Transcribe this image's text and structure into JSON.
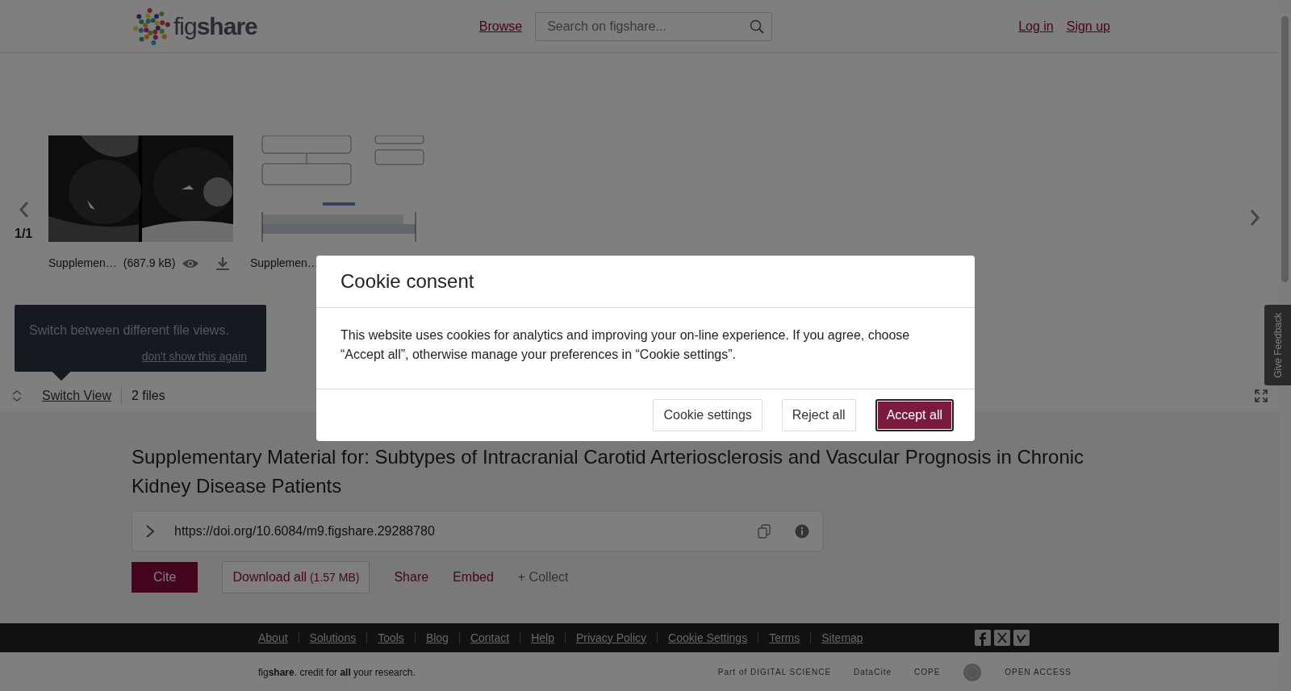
{
  "header": {
    "logo": "fig**share**",
    "browse": "Browse",
    "search": {
      "placeholder": "Search on figshare..."
    },
    "auth_links": [
      "Log in",
      "Sign up"
    ]
  },
  "viewer": {
    "counter": "1/1",
    "files": [
      {
        "name": "Supplemen…",
        "size": "(687.9 kB)",
        "kind": "scan"
      },
      {
        "name": "Supplemen…",
        "kind": "chart"
      }
    ],
    "tooltip": {
      "text": "Switch between different file views.",
      "dismiss": "don't show this again"
    },
    "switch_view": "Switch View",
    "file_count": "2 files"
  },
  "item": {
    "title": "Supplementary Material for: Subtypes of Intracranial Carotid Arteriosclerosis and Vascular Prognosis in Chronic Kidney Disease Patients",
    "doi": "https://doi.org/10.6084/m9.figshare.29288780",
    "actions": [
      {
        "label": "Cite",
        "kind": "primary"
      },
      {
        "label": "Download all",
        "size": "(1.57 MB)",
        "kind": "outline"
      },
      {
        "label": "Share",
        "kind": "link"
      },
      {
        "label": "Embed",
        "kind": "link"
      },
      {
        "label": "+ Collect",
        "kind": "muted"
      }
    ]
  },
  "footer": {
    "links": [
      "About",
      "Solutions",
      "Tools",
      "Blog",
      "Contact",
      "Help",
      "Privacy Policy",
      "Cookie Settings",
      "Terms",
      "Sitemap"
    ],
    "tagline": "fig**share**. credit for **all** your research.",
    "partners": [
      {
        "kind": "text",
        "text": "Part of DIGITAL SCIENCE"
      },
      {
        "kind": "text",
        "text": "DataCite"
      },
      {
        "kind": "text",
        "text": "COPE"
      },
      {
        "kind": "emblem"
      },
      {
        "kind": "text",
        "text": "OPEN ACCESS"
      }
    ]
  },
  "feedback_tab": "Give Feedback",
  "cookie_modal": {
    "title": "Cookie consent",
    "body": "This website uses cookies for analytics and improving your on-line experience. If you agree, choose “Accept all”, otherwise manage your preferences in “Cookie settings”.",
    "buttons": [
      {
        "label": "Cookie settings",
        "kind": "outline",
        "focused": false
      },
      {
        "label": "Reject all",
        "kind": "outline",
        "focused": false
      },
      {
        "label": "Accept all",
        "kind": "primary",
        "focused": true
      }
    ]
  }
}
